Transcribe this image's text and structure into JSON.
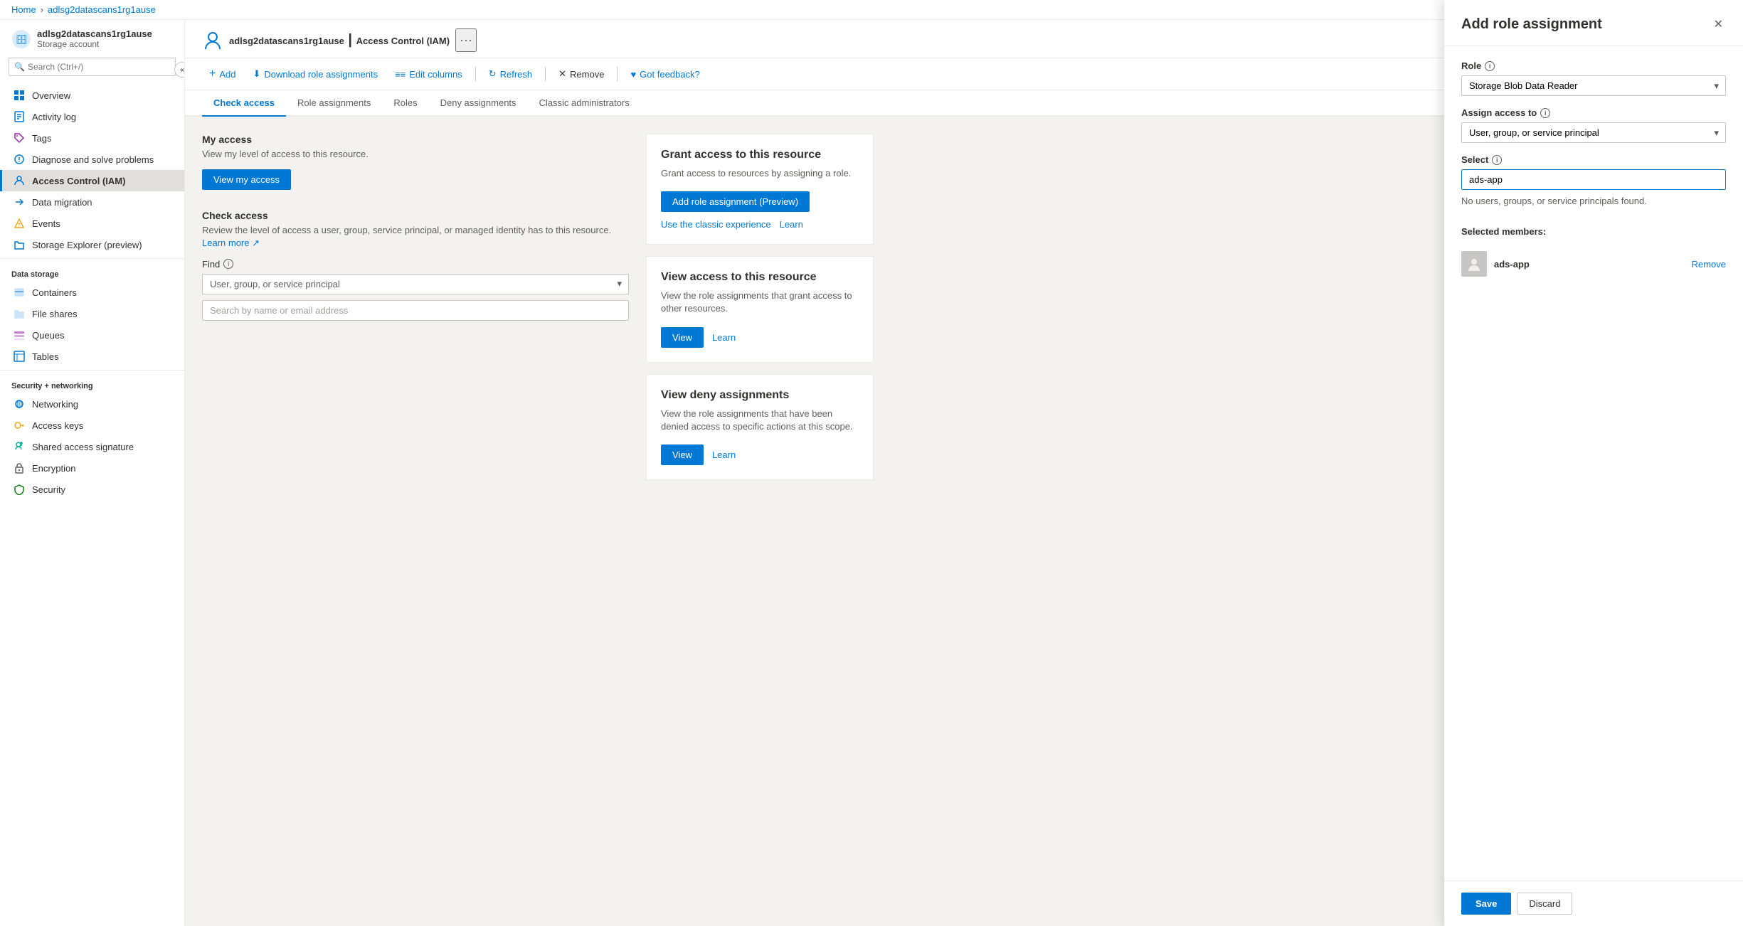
{
  "breadcrumb": {
    "home": "Home",
    "resource": "adlsg2datascans1rg1ause"
  },
  "resource": {
    "name": "adlsg2datascans1rg1ause",
    "type": "Storage account",
    "page": "Access Control (IAM)"
  },
  "toolbar": {
    "add_label": "Add",
    "download_label": "Download role assignments",
    "edit_columns_label": "Edit columns",
    "refresh_label": "Refresh",
    "remove_label": "Remove",
    "feedback_label": "Got feedback?"
  },
  "tabs": [
    {
      "id": "check-access",
      "label": "Check access",
      "active": true
    },
    {
      "id": "role-assignments",
      "label": "Role assignments",
      "active": false
    },
    {
      "id": "roles",
      "label": "Roles",
      "active": false
    },
    {
      "id": "deny-assignments",
      "label": "Deny assignments",
      "active": false
    },
    {
      "id": "classic-administrators",
      "label": "Classic administrators",
      "active": false
    }
  ],
  "check_access": {
    "my_access": {
      "title": "My access",
      "description": "View my level of access to this resource.",
      "button_label": "View my access"
    },
    "check_access": {
      "title": "Check access",
      "description": "Review the level of access a user, group, service principal, or managed identity has to this resource.",
      "learn_more": "Learn more",
      "find_label": "Find",
      "dropdown_placeholder": "User, group, or service principal",
      "search_placeholder": "Search by name or email address"
    }
  },
  "cards": {
    "grant_access": {
      "title": "Grant access to this resource",
      "description": "Grant access to resources by assigning a role.",
      "button_label": "Add role assignment (Preview)",
      "link_label": "Use the classic experience",
      "learn_label": "Learn"
    },
    "view_access": {
      "title": "View access to this resource",
      "description": "View the role assignments that grant access to other resources.",
      "button_label": "View",
      "learn_label": "Learn"
    },
    "view_deny": {
      "title": "View deny assignments",
      "description": "View the role assignments that have been denied access to specific actions at this scope.",
      "button_label": "View",
      "learn_label": "Learn"
    }
  },
  "panel": {
    "title": "Add role assignment",
    "role_label": "Role",
    "role_info": "i",
    "role_value": "Storage Blob Data Reader",
    "assign_access_label": "Assign access to",
    "assign_access_info": "i",
    "assign_access_value": "User, group, or service principal",
    "select_label": "Select",
    "select_info": "i",
    "select_placeholder": "ads-app",
    "no_results": "No users, groups, or service principals found.",
    "selected_members_label": "Selected members:",
    "member_name": "ads-app",
    "remove_label": "Remove",
    "save_label": "Save",
    "discard_label": "Discard"
  },
  "sidebar": {
    "search_placeholder": "Search (Ctrl+/)",
    "nav_items": [
      {
        "id": "overview",
        "label": "Overview",
        "icon": "overview"
      },
      {
        "id": "activity-log",
        "label": "Activity log",
        "icon": "activity"
      },
      {
        "id": "tags",
        "label": "Tags",
        "icon": "tags"
      },
      {
        "id": "diagnose",
        "label": "Diagnose and solve problems",
        "icon": "diagnose"
      },
      {
        "id": "iam",
        "label": "Access Control (IAM)",
        "icon": "iam",
        "active": true
      }
    ],
    "data_storage_label": "Data storage",
    "data_storage_items": [
      {
        "id": "containers",
        "label": "Containers",
        "icon": "containers"
      },
      {
        "id": "fileshares",
        "label": "File shares",
        "icon": "fileshares"
      },
      {
        "id": "queues",
        "label": "Queues",
        "icon": "queues"
      },
      {
        "id": "tables",
        "label": "Tables",
        "icon": "tables"
      }
    ],
    "migration_items": [
      {
        "id": "migration",
        "label": "Data migration",
        "icon": "migration"
      },
      {
        "id": "events",
        "label": "Events",
        "icon": "events"
      },
      {
        "id": "explorer",
        "label": "Storage Explorer (preview)",
        "icon": "explorer"
      }
    ],
    "security_label": "Security + networking",
    "security_items": [
      {
        "id": "networking",
        "label": "Networking",
        "icon": "networking"
      },
      {
        "id": "accesskeys",
        "label": "Access keys",
        "icon": "accesskeys"
      },
      {
        "id": "sas",
        "label": "Shared access signature",
        "icon": "sas"
      },
      {
        "id": "encryption",
        "label": "Encryption",
        "icon": "encryption"
      },
      {
        "id": "security",
        "label": "Security",
        "icon": "security"
      }
    ]
  }
}
